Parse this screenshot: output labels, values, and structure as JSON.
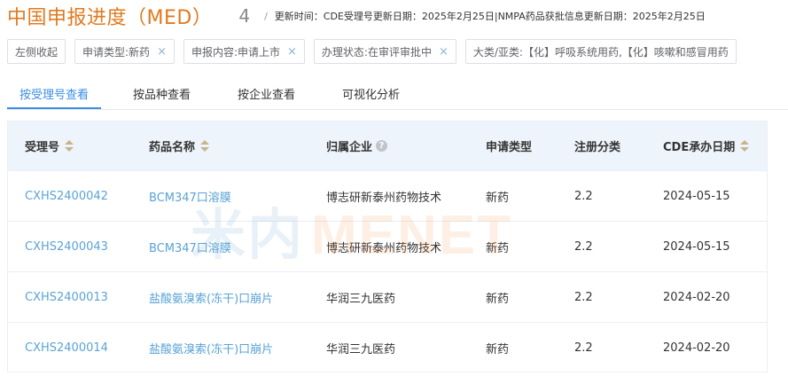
{
  "header": {
    "title": "中国申报进度（MED）",
    "count": "4",
    "separator": "/",
    "update_text": "更新时间：CDE受理号更新日期：2025年2月25日|NMPA药品获批信息更新日期：2025年2月25日"
  },
  "filters": [
    {
      "label": "左侧收起",
      "closable": false
    },
    {
      "label": "申请类型:新药",
      "closable": true
    },
    {
      "label": "申报内容:申请上市",
      "closable": true
    },
    {
      "label": "办理状态:在审评审批中",
      "closable": true
    },
    {
      "label": "大类/亚类:【化】呼吸系统用药,【化】咳嗽和感冒用药",
      "closable": false
    }
  ],
  "close_glyph": "×",
  "tabs": [
    {
      "label": "按受理号查看",
      "active": true
    },
    {
      "label": "按品种查看",
      "active": false
    },
    {
      "label": "按企业查看",
      "active": false
    },
    {
      "label": "可视化分析",
      "active": false
    }
  ],
  "table": {
    "columns": [
      "受理号",
      "药品名称",
      "归属企业",
      "申请类型",
      "注册分类",
      "CDE承办日期"
    ],
    "help_glyph": "?",
    "rows": [
      [
        "CXHS2400042",
        "BCM347口溶膜",
        "博志研新泰州药物技术",
        "新药",
        "2.2",
        "2024-05-15"
      ],
      [
        "CXHS2400043",
        "BCM347口溶膜",
        "博志研新泰州药物技术",
        "新药",
        "2.2",
        "2024-05-15"
      ],
      [
        "CXHS2400013",
        "盐酸氨溴索(冻干)口崩片",
        "华润三九医药",
        "新药",
        "2.2",
        "2024-02-20"
      ],
      [
        "CXHS2400014",
        "盐酸氨溴索(冻干)口崩片",
        "华润三九医药",
        "新药",
        "2.2",
        "2024-02-20"
      ]
    ]
  },
  "watermark": {
    "part_a": "米内",
    "part_b": "MENET"
  },
  "colors": {
    "accent": "#3a8ee6",
    "title": "#e07a1f",
    "link": "#5aa3d6"
  }
}
